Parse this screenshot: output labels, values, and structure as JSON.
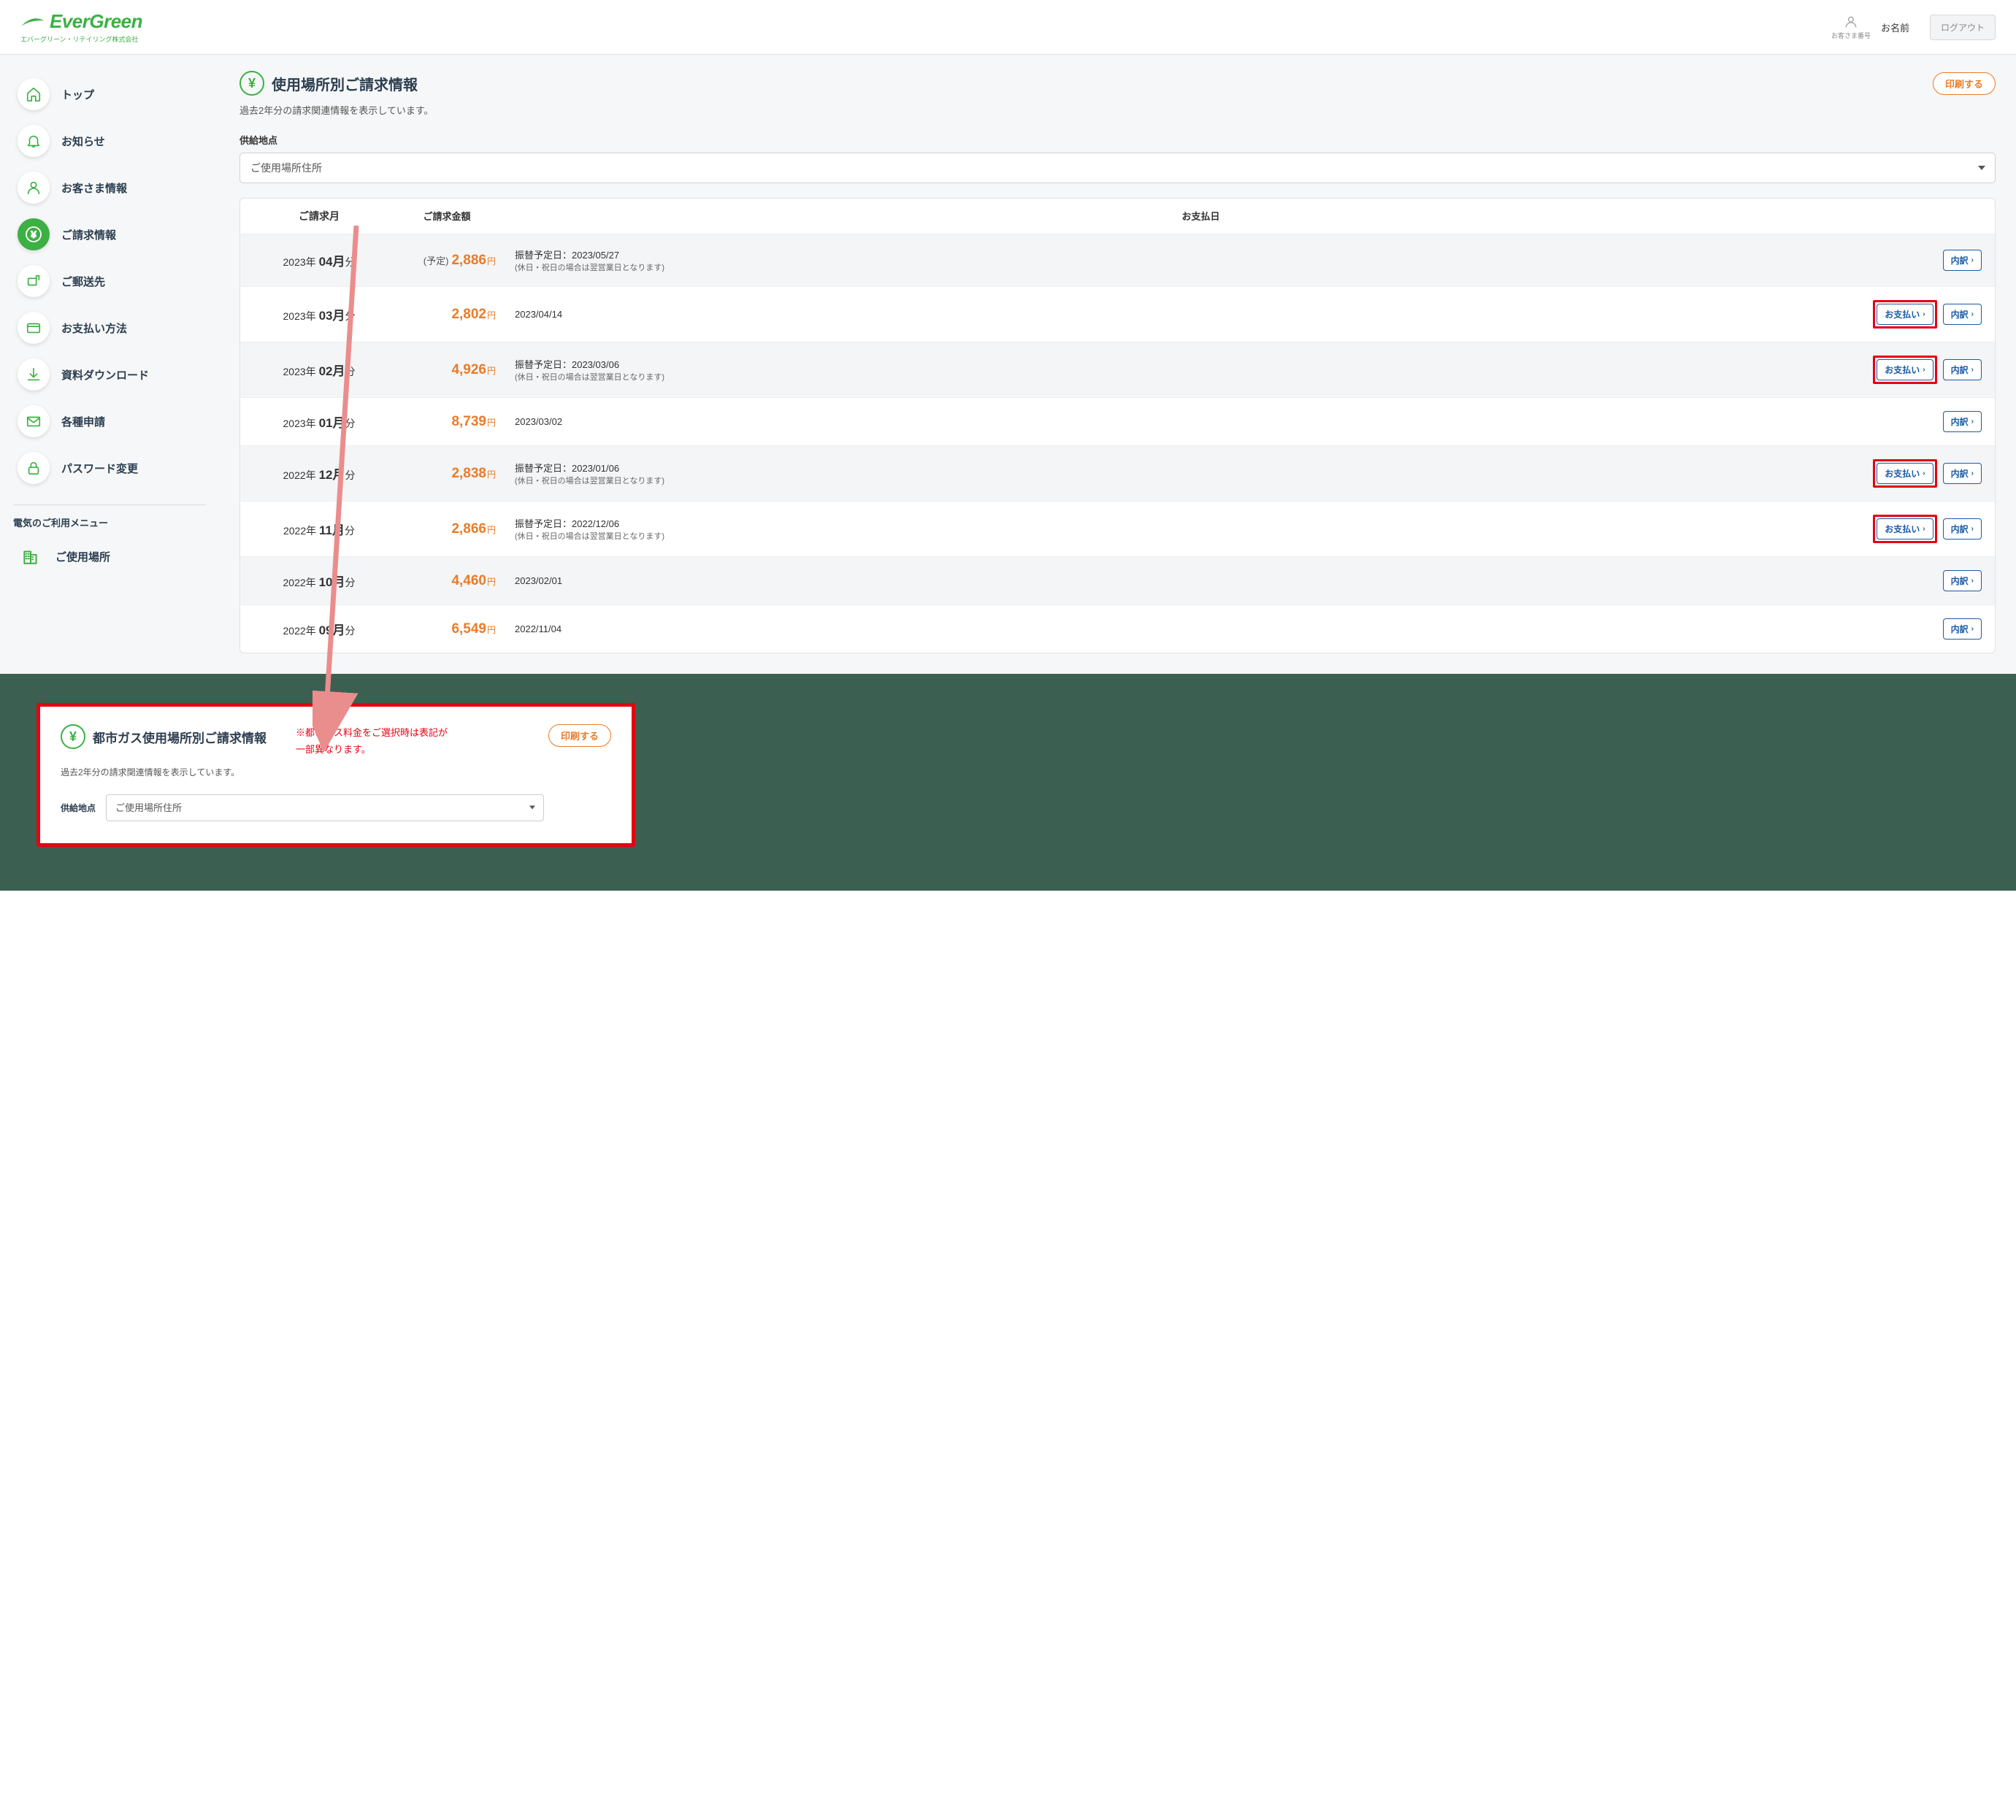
{
  "header": {
    "logo_main": "EverGreen",
    "logo_sub": "エバーグリーン・リテイリング株式会社",
    "user_icon_label": "お客さま番号",
    "user_name": "お名前",
    "logout": "ログアウト"
  },
  "sidebar": {
    "items": [
      {
        "label": "トップ",
        "icon": "home"
      },
      {
        "label": "お知らせ",
        "icon": "bell"
      },
      {
        "label": "お客さま情報",
        "icon": "user"
      },
      {
        "label": "ご請求情報",
        "icon": "yen",
        "active": true
      },
      {
        "label": "ご郵送先",
        "icon": "mailbox"
      },
      {
        "label": "お支払い方法",
        "icon": "card"
      },
      {
        "label": "資料ダウンロード",
        "icon": "download"
      },
      {
        "label": "各種申請",
        "icon": "envelope"
      },
      {
        "label": "パスワード変更",
        "icon": "lock"
      }
    ],
    "section_title": "電気のご利用メニュー",
    "sub_items": [
      {
        "label": "ご使用場所",
        "icon": "building"
      }
    ]
  },
  "main": {
    "title": "使用場所別ご請求情報",
    "print": "印刷する",
    "desc": "過去2年分の請求関連情報を表示しています。",
    "supply_label": "供給地点",
    "supply_option": "ご使用場所住所",
    "table": {
      "h_month": "ご請求月",
      "h_amount": "ご請求金額",
      "h_date": "お支払日",
      "pending_prefix": "(予定)",
      "pay_label": "お支払い",
      "detail_label": "内訳",
      "holiday_note": "(休日・祝日の場合は翌営業日となります)",
      "rows": [
        {
          "year": "2023年",
          "month": "04月",
          "suffix": "分",
          "amount": "2,886",
          "date_main": "振替予定日：2023/05/27",
          "holiday": true,
          "pending": true,
          "pay": false,
          "highlight": false,
          "alt": true
        },
        {
          "year": "2023年",
          "month": "03月",
          "suffix": "分",
          "amount": "2,802",
          "date_main": "2023/04/14",
          "holiday": false,
          "pending": false,
          "pay": true,
          "highlight": true,
          "alt": false
        },
        {
          "year": "2023年",
          "month": "02月",
          "suffix": "分",
          "amount": "4,926",
          "date_main": "振替予定日：2023/03/06",
          "holiday": true,
          "pending": false,
          "pay": true,
          "highlight": true,
          "alt": true
        },
        {
          "year": "2023年",
          "month": "01月",
          "suffix": "分",
          "amount": "8,739",
          "date_main": "2023/03/02",
          "holiday": false,
          "pending": false,
          "pay": false,
          "highlight": false,
          "alt": false
        },
        {
          "year": "2022年",
          "month": "12月",
          "suffix": "分",
          "amount": "2,838",
          "date_main": "振替予定日：2023/01/06",
          "holiday": true,
          "pending": false,
          "pay": true,
          "highlight": true,
          "alt": true
        },
        {
          "year": "2022年",
          "month": "11月",
          "suffix": "分",
          "amount": "2,866",
          "date_main": "振替予定日：2022/12/06",
          "holiday": true,
          "pending": false,
          "pay": true,
          "highlight": true,
          "alt": false
        },
        {
          "year": "2022年",
          "month": "10月",
          "suffix": "分",
          "amount": "4,460",
          "date_main": "2023/02/01",
          "holiday": false,
          "pending": false,
          "pay": false,
          "highlight": false,
          "alt": true
        },
        {
          "year": "2022年",
          "month": "09月",
          "suffix": "分",
          "amount": "6,549",
          "date_main": "2022/11/04",
          "holiday": false,
          "pending": false,
          "pay": false,
          "highlight": false,
          "alt": false
        }
      ]
    }
  },
  "annotation": {
    "title": "都市ガス使用場所別ご請求情報",
    "note_l1": "※都市ガス料金をご選択時は表記が",
    "note_l2": "一部異なります。",
    "print": "印刷する",
    "desc": "過去2年分の請求関連情報を表示しています。",
    "supply_label": "供給地点",
    "supply_option": "ご使用場所住所"
  }
}
